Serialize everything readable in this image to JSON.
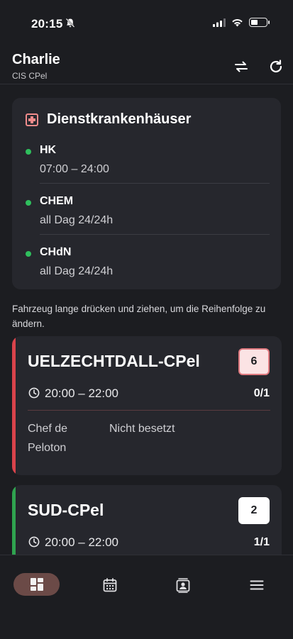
{
  "status_bar": {
    "time": "20:15"
  },
  "header": {
    "title": "Charlie",
    "subtitle": "CIS CPel"
  },
  "hospitals": {
    "title": "Dienstkrankenhäuser",
    "items": [
      {
        "name": "HK",
        "hours": "07:00 – 24:00"
      },
      {
        "name": "CHEM",
        "hours": "all Dag 24/24h"
      },
      {
        "name": "CHdN",
        "hours": "all Dag 24/24h"
      }
    ]
  },
  "hint": "Fahrzeug lange drücken und ziehen, um die Reihenfolge zu ändern.",
  "vehicles": [
    {
      "name": "UELZECHTDALL-CPel",
      "badge": "6",
      "time": "20:00 – 22:00",
      "count": "0/1",
      "accent": "#d9434b",
      "badge_bg": "#fbe3e4",
      "badge_border": "#e07a80",
      "role": "Chef de Peloton",
      "status": "Nicht besetzt"
    },
    {
      "name": "SUD-CPel",
      "badge": "2",
      "time": "20:00 – 22:00",
      "count": "1/1",
      "accent": "#2fa34f",
      "badge_bg": "#ffffff",
      "badge_border": "#ffffff"
    }
  ],
  "nav": {
    "items": [
      {
        "icon": "dashboard-icon",
        "active": true
      },
      {
        "icon": "calendar-icon",
        "active": false
      },
      {
        "icon": "contact-card-icon",
        "active": false
      },
      {
        "icon": "menu-icon",
        "active": false
      }
    ]
  },
  "colors": {
    "background": "#1c1d21",
    "card": "#26272d",
    "active_nav": "#6b4a47",
    "status_green": "#2fbf5d"
  }
}
